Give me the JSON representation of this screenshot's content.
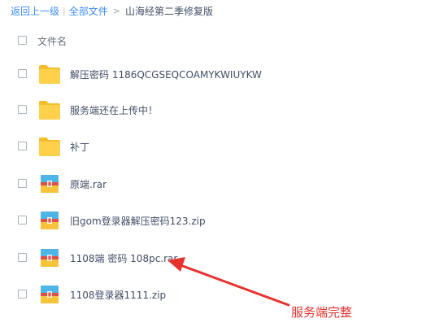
{
  "breadcrumb": {
    "back": "返回上一级",
    "separator": "|",
    "all_files": "全部文件",
    "arrow": ">",
    "current": "山海经第二季修复版"
  },
  "list_header": {
    "name_label": "文件名"
  },
  "files": [
    {
      "type": "folder",
      "name": "解压密码 1186QCGSEQCOAMYKWIUYKW"
    },
    {
      "type": "folder",
      "name": "服务端还在上传中！"
    },
    {
      "type": "folder",
      "name": "补丁"
    },
    {
      "type": "archive",
      "name": "原端.rar"
    },
    {
      "type": "archive",
      "name": "旧gom登录器解压密码123.zip"
    },
    {
      "type": "archive",
      "name": "1108端 密码 108pc.rar"
    },
    {
      "type": "archive",
      "name": "1108登录器1111.zip"
    }
  ],
  "annotation": {
    "text": "服务端完整",
    "color": "#e8322e"
  },
  "colors": {
    "link": "#3b8cff",
    "folder": "#ffd04b",
    "folder_dark": "#f5bd2a",
    "archive_top": "#4db6e6",
    "archive_bottom": "#f6c33a",
    "archive_band": "#e24e43"
  },
  "icons": {
    "folder": "folder-icon",
    "archive": "archive-file-icon"
  }
}
